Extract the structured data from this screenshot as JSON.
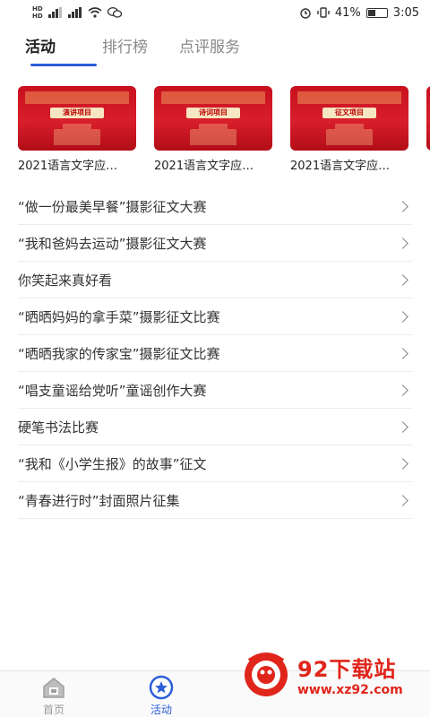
{
  "status_bar": {
    "battery": "41%",
    "time": "3:05",
    "battery_level": 0.41
  },
  "tabs": [
    {
      "label": "活动",
      "active": true
    },
    {
      "label": "排行榜",
      "active": false
    },
    {
      "label": "点评服务",
      "active": false
    }
  ],
  "cards": [
    {
      "title": "2021语言文字应…",
      "banner": "演讲项目"
    },
    {
      "title": "2021语言文字应…",
      "banner": "诗词项目"
    },
    {
      "title": "2021语言文字应…",
      "banner": "征文项目"
    }
  ],
  "list": [
    {
      "label": "“做一份最美早餐”摄影征文大赛"
    },
    {
      "label": "“我和爸妈去运动”摄影征文大赛"
    },
    {
      "label": "你笑起来真好看"
    },
    {
      "label": "“晒晒妈妈的拿手菜”摄影征文比赛"
    },
    {
      "label": "“晒晒我家的传家宝”摄影征文比赛"
    },
    {
      "label": "“唱支童谣给党听”童谣创作大赛"
    },
    {
      "label": "硬笔书法比赛"
    },
    {
      "label": "“我和《小学生报》的故事”征文"
    },
    {
      "label": "“青春进行时”封面照片征集"
    }
  ],
  "bottom_nav": {
    "home": "首页",
    "activity": "活动"
  },
  "watermark": {
    "title": "92下载站",
    "url": "www.xz92.com"
  },
  "colors": {
    "accent": "#2b5fd9",
    "card_red": "#c8101e",
    "watermark_red": "#e0251b"
  }
}
